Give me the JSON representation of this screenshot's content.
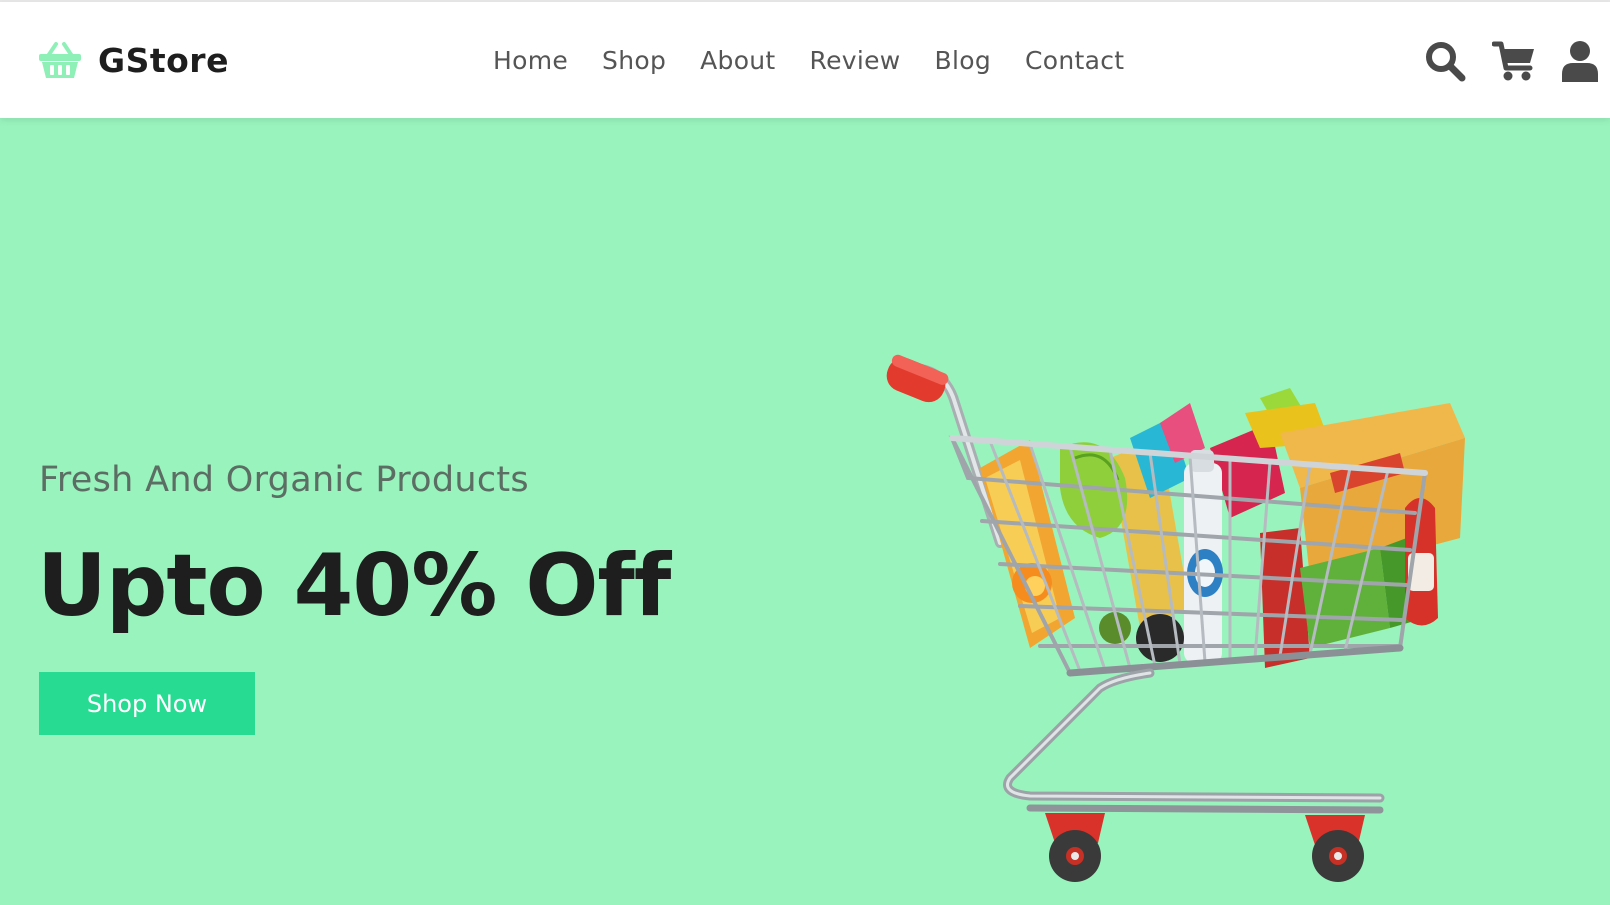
{
  "brand": {
    "name": "GStore",
    "icon": "basket-icon",
    "accent": "#8ef0b6"
  },
  "nav": {
    "items": [
      {
        "label": "Home"
      },
      {
        "label": "Shop"
      },
      {
        "label": "About"
      },
      {
        "label": "Review"
      },
      {
        "label": "Blog"
      },
      {
        "label": "Contact"
      }
    ]
  },
  "header_icons": [
    "search-icon",
    "cart-icon",
    "user-icon"
  ],
  "hero": {
    "subtitle": "Fresh And Organic Products",
    "title": "Upto 40% Off",
    "cta_label": "Shop Now",
    "cta_color": "#27dc92",
    "background": "#99f3bd",
    "illustration": "shopping-cart-with-groceries"
  }
}
